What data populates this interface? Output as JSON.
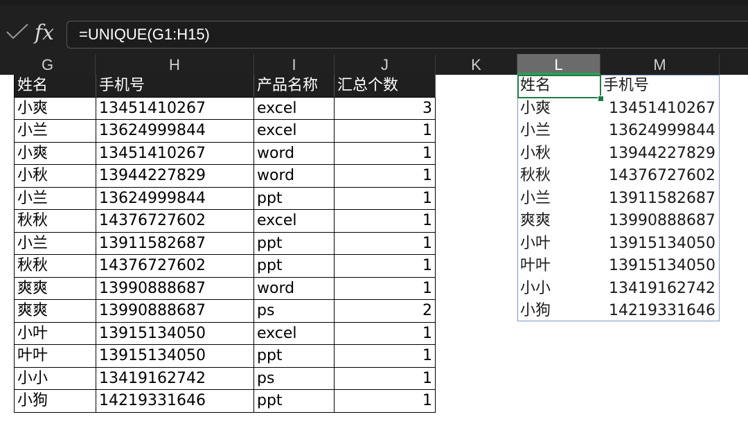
{
  "formula_bar": {
    "confirm_icon": "checkmark-icon",
    "fx_label": "fx",
    "formula": "=UNIQUE(G1:H15)"
  },
  "columns": [
    "G",
    "H",
    "I",
    "J",
    "K",
    "L",
    "M"
  ],
  "selected_column": "L",
  "source_table": {
    "headers": [
      "姓名",
      "手机号",
      "产品名称",
      "汇总个数"
    ],
    "rows": [
      [
        "小爽",
        "13451410267",
        "excel",
        "3"
      ],
      [
        "小兰",
        "13624999844",
        "excel",
        "1"
      ],
      [
        "小爽",
        "13451410267",
        "word",
        "1"
      ],
      [
        "小秋",
        "13944227829",
        "word",
        "1"
      ],
      [
        "小兰",
        "13624999844",
        "ppt",
        "1"
      ],
      [
        "秋秋",
        "14376727602",
        "excel",
        "1"
      ],
      [
        "小兰",
        "13911582687",
        "ppt",
        "1"
      ],
      [
        "秋秋",
        "14376727602",
        "ppt",
        "1"
      ],
      [
        "爽爽",
        "13990888687",
        "word",
        "1"
      ],
      [
        "爽爽",
        "13990888687",
        "ps",
        "2"
      ],
      [
        "小叶",
        "13915134050",
        "excel",
        "1"
      ],
      [
        "叶叶",
        "13915134050",
        "ppt",
        "1"
      ],
      [
        "小小",
        "13419162742",
        "ps",
        "1"
      ],
      [
        "小狗",
        "14219331646",
        "ppt",
        "1"
      ]
    ]
  },
  "unique_result": {
    "headers": [
      "姓名",
      "手机号"
    ],
    "rows": [
      [
        "小爽",
        "13451410267"
      ],
      [
        "小兰",
        "13624999844"
      ],
      [
        "小秋",
        "13944227829"
      ],
      [
        "秋秋",
        "14376727602"
      ],
      [
        "小兰",
        "13911582687"
      ],
      [
        "爽爽",
        "13990888687"
      ],
      [
        "小叶",
        "13915134050"
      ],
      [
        "叶叶",
        "13915134050"
      ],
      [
        "小小",
        "13419162742"
      ],
      [
        "小狗",
        "14219331646"
      ]
    ]
  },
  "colors": {
    "header_fill": "#1f1f1f",
    "selection_border": "#1f7a45",
    "spill_border": "#7b95c9"
  }
}
